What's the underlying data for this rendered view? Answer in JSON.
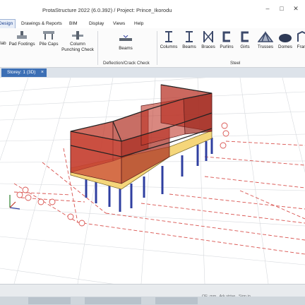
{
  "window": {
    "title": "ProtaStructure 2022 (6.0.392) / Project: Prince_Ikorodu"
  },
  "menu": {
    "tabs": [
      "Design",
      "Drawings & Reports",
      "BIM",
      "Display",
      "Views",
      "Help"
    ]
  },
  "ribbon": {
    "buttons": {
      "slab": "Slab",
      "pad_footings": "Pad Footings",
      "pile_caps": "Pile Caps",
      "column_punching_check_1": "Column",
      "column_punching_check_2": "Punching Check",
      "beams": "Beams",
      "columns": "Columns",
      "beams_steel": "Beams",
      "braces": "Braces",
      "purlins": "Purlins",
      "girts": "Girts",
      "trusses": "Trusses",
      "domes": "Domes",
      "frames": "Fram"
    },
    "groups": {
      "deflection": "Deflection/Crack Check",
      "steel": "Steel"
    }
  },
  "document_tab": {
    "label": "Storey: 1 (3D)",
    "close": "×"
  },
  "status": {
    "text": "OE: mm , Ark strive , Sign in"
  },
  "colors": {
    "accent": "#3c6fb5",
    "wall_fill": "#c0392b",
    "column": "#2f3fa0",
    "grid_lines": "#d9534f"
  }
}
